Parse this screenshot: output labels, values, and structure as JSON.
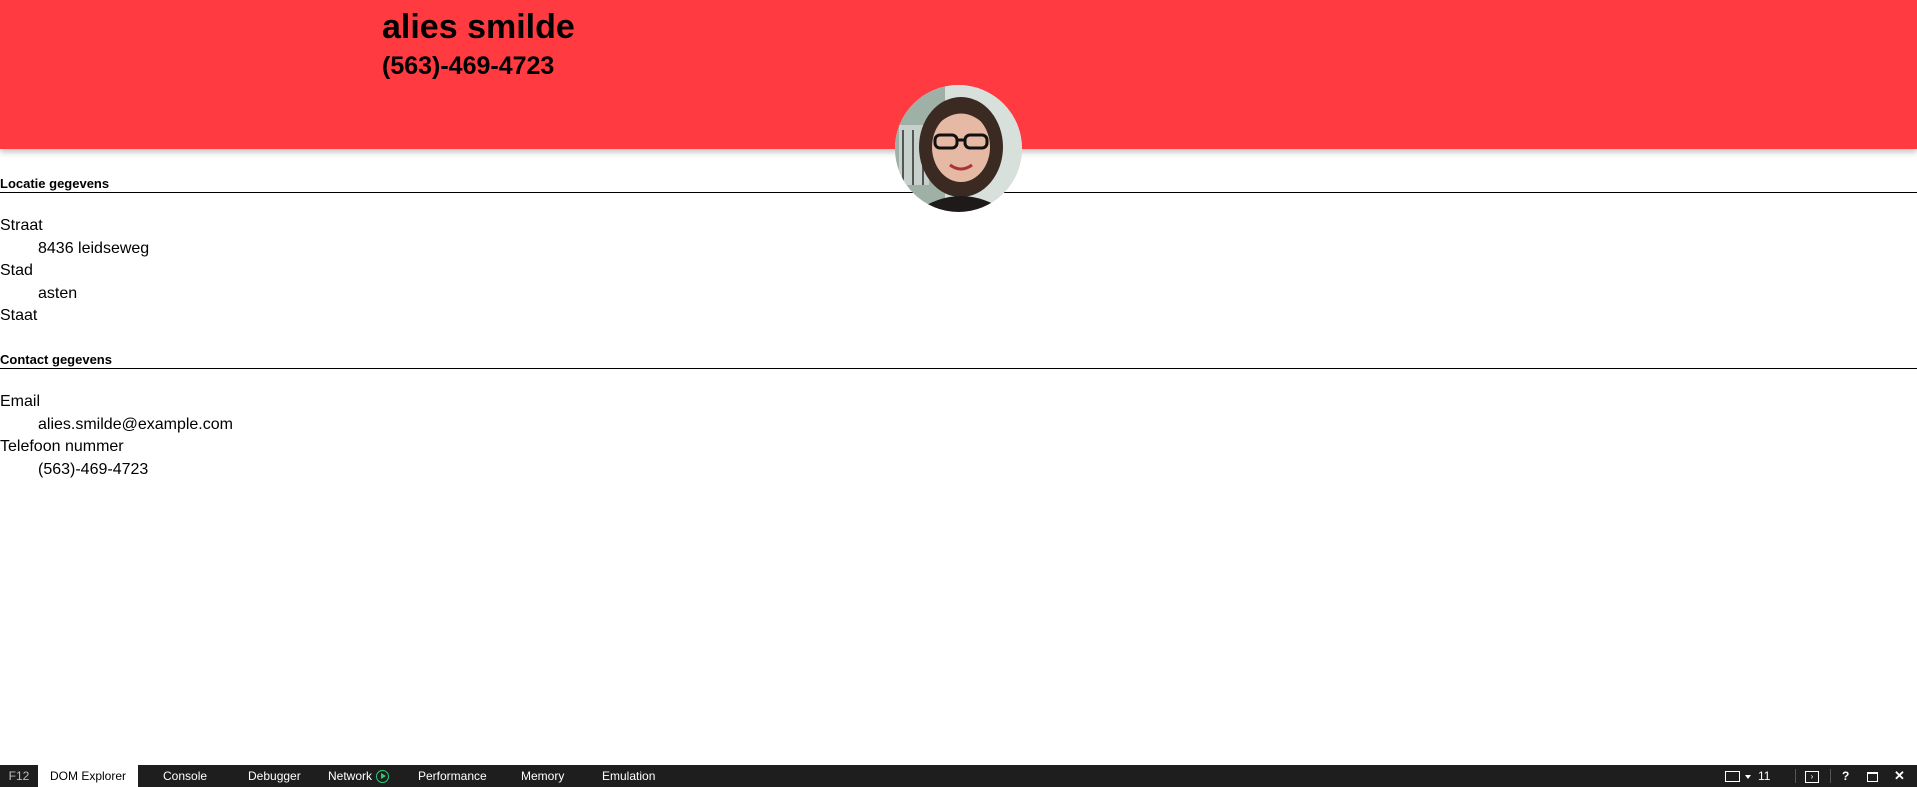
{
  "profile": {
    "name": "alies smilde",
    "phone": "(563)-469-4723"
  },
  "location": {
    "title": "Locatie gegevens",
    "street_label": "Straat",
    "street_value": "8436 leidseweg",
    "city_label": "Stad",
    "city_value": "asten",
    "state_label": "Staat",
    "state_value": ""
  },
  "contact": {
    "title": "Contact gegevens",
    "email_label": "Email",
    "email_value": "alies.smilde@example.com",
    "phone_label": "Telefoon nummer",
    "phone_value": "(563)-469-4723"
  },
  "devtools": {
    "f12_label": "F12",
    "tabs": [
      "DOM Explorer",
      "Console",
      "Debugger",
      "Network",
      "Performance",
      "Memory",
      "Emulation"
    ],
    "active_tab": "DOM Explorer",
    "document_mode": "11",
    "icons": [
      "network-play-icon",
      "device-icon",
      "dropdown-arrow-icon",
      "console-icon",
      "help-icon",
      "undock-icon",
      "close-icon"
    ]
  },
  "colors": {
    "header_bg": "#ff3a40",
    "devtools_bg": "#1e1e1e",
    "network_indicator": "#2ecc71"
  }
}
